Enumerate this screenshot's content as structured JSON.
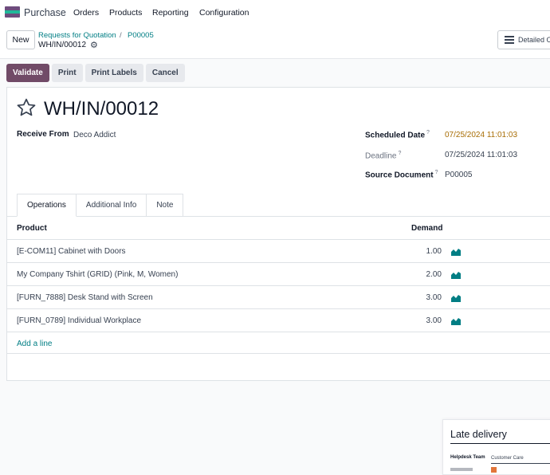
{
  "app": {
    "name": "Purchase"
  },
  "menu": [
    "Orders",
    "Products",
    "Reporting",
    "Configuration"
  ],
  "control": {
    "new_label": "New",
    "breadcrumb_parent": "Requests for Quotation",
    "breadcrumb_sep": "/",
    "breadcrumb_po": "P00005",
    "breadcrumb_current": "WH/IN/00012",
    "view_button_label": "Detailed O"
  },
  "actions": {
    "validate": "Validate",
    "print": "Print",
    "print_labels": "Print Labels",
    "cancel": "Cancel"
  },
  "record": {
    "title": "WH/IN/00012",
    "receive_from_label": "Receive From",
    "receive_from_value": "Deco Addict",
    "scheduled_date_label": "Scheduled Date",
    "scheduled_date_value": "07/25/2024 11:01:03",
    "deadline_label": "Deadline",
    "deadline_value": "07/25/2024 11:01:03",
    "source_document_label": "Source Document",
    "source_document_value": "P00005",
    "help_mark": "?"
  },
  "tabs": [
    "Operations",
    "Additional Info",
    "Note"
  ],
  "table": {
    "headers": {
      "product": "Product",
      "demand": "Demand"
    },
    "rows": [
      {
        "product": "[E-COM11] Cabinet with Doors",
        "demand": "1.00"
      },
      {
        "product": "My Company Tshirt (GRID) (Pink, M, Women)",
        "demand": "2.00"
      },
      {
        "product": "[FURN_7888] Desk Stand with Screen",
        "demand": "3.00"
      },
      {
        "product": "[FURN_0789] Individual Workplace",
        "demand": "3.00"
      }
    ],
    "add_line": "Add a line"
  },
  "late_delivery": {
    "title": "Late delivery",
    "team_label": "Helpdesk Team",
    "team_value": "Customer Care"
  },
  "colors": {
    "primary": "#714b67",
    "link": "#017e84",
    "warning": "#a86d05"
  }
}
